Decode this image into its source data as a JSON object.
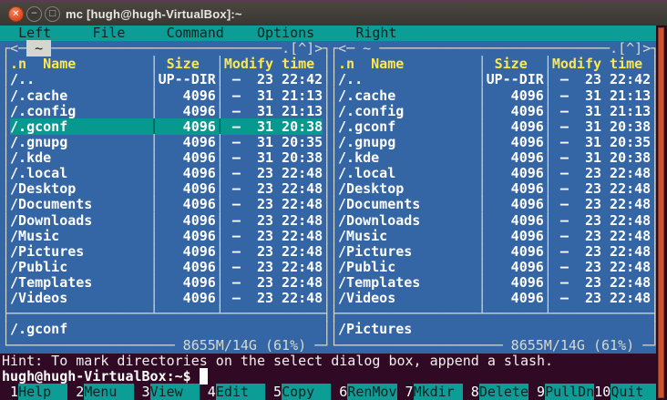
{
  "window": {
    "title": "mc [hugh@hugh-VirtualBox]:~",
    "buttons": {
      "close": "close-icon",
      "minimize": "minimize-icon",
      "maximize": "maximize-icon"
    }
  },
  "menu": {
    "items": [
      {
        "label": "Left"
      },
      {
        "label": "File"
      },
      {
        "label": "Command"
      },
      {
        "label": "Options"
      },
      {
        "label": "Right"
      }
    ]
  },
  "panel_chrome": {
    "history_back": "<",
    "history_forward": ">",
    "cd_up": "[^]",
    "show_hidden": ".",
    "date_dash": "—"
  },
  "columns": {
    "sort_indicator": ".n",
    "name": "Name",
    "size": "Size",
    "mtime": "Modify time"
  },
  "panels": {
    "left": {
      "path": "~",
      "active": true,
      "selected_index": 3,
      "mini_status": "/.gconf",
      "disk_usage": "8655M/14G (61%)",
      "files": [
        {
          "name": "/..",
          "size": "UP--DIR",
          "time": "23 22:42"
        },
        {
          "name": "/.cache",
          "size": "4096",
          "time": "31 21:13"
        },
        {
          "name": "/.config",
          "size": "4096",
          "time": "31 21:13"
        },
        {
          "name": "/.gconf",
          "size": "4096",
          "time": "31 20:38"
        },
        {
          "name": "/.gnupg",
          "size": "4096",
          "time": "31 20:35"
        },
        {
          "name": "/.kde",
          "size": "4096",
          "time": "31 20:38"
        },
        {
          "name": "/.local",
          "size": "4096",
          "time": "23 22:48"
        },
        {
          "name": "/Desktop",
          "size": "4096",
          "time": "23 22:48"
        },
        {
          "name": "/Documents",
          "size": "4096",
          "time": "23 22:48"
        },
        {
          "name": "/Downloads",
          "size": "4096",
          "time": "23 22:48"
        },
        {
          "name": "/Music",
          "size": "4096",
          "time": "23 22:48"
        },
        {
          "name": "/Pictures",
          "size": "4096",
          "time": "23 22:48"
        },
        {
          "name": "/Public",
          "size": "4096",
          "time": "23 22:48"
        },
        {
          "name": "/Templates",
          "size": "4096",
          "time": "23 22:48"
        },
        {
          "name": "/Videos",
          "size": "4096",
          "time": "23 22:48"
        }
      ]
    },
    "right": {
      "path": "~",
      "active": false,
      "selected_index": -1,
      "mini_status": "/Pictures",
      "disk_usage": "8655M/14G (61%)",
      "files": [
        {
          "name": "/..",
          "size": "UP--DIR",
          "time": "23 22:42"
        },
        {
          "name": "/.cache",
          "size": "4096",
          "time": "31 21:13"
        },
        {
          "name": "/.config",
          "size": "4096",
          "time": "31 21:13"
        },
        {
          "name": "/.gconf",
          "size": "4096",
          "time": "31 20:38"
        },
        {
          "name": "/.gnupg",
          "size": "4096",
          "time": "31 20:35"
        },
        {
          "name": "/.kde",
          "size": "4096",
          "time": "31 20:38"
        },
        {
          "name": "/.local",
          "size": "4096",
          "time": "23 22:48"
        },
        {
          "name": "/Desktop",
          "size": "4096",
          "time": "23 22:48"
        },
        {
          "name": "/Documents",
          "size": "4096",
          "time": "23 22:48"
        },
        {
          "name": "/Downloads",
          "size": "4096",
          "time": "23 22:48"
        },
        {
          "name": "/Music",
          "size": "4096",
          "time": "23 22:48"
        },
        {
          "name": "/Pictures",
          "size": "4096",
          "time": "23 22:48"
        },
        {
          "name": "/Public",
          "size": "4096",
          "time": "23 22:48"
        },
        {
          "name": "/Templates",
          "size": "4096",
          "time": "23 22:48"
        },
        {
          "name": "/Videos",
          "size": "4096",
          "time": "23 22:48"
        }
      ]
    }
  },
  "hint": "Hint: To mark directories on the select dialog box, append a slash.",
  "prompt": "hugh@hugh-VirtualBox:~$",
  "keybar": [
    {
      "num": "1",
      "label": "Help"
    },
    {
      "num": "2",
      "label": "Menu"
    },
    {
      "num": "3",
      "label": "View"
    },
    {
      "num": "4",
      "label": "Edit"
    },
    {
      "num": "5",
      "label": "Copy"
    },
    {
      "num": "6",
      "label": "RenMov"
    },
    {
      "num": "7",
      "label": "Mkdir"
    },
    {
      "num": "8",
      "label": "Delete"
    },
    {
      "num": "9",
      "label": "PullDn"
    },
    {
      "num": "10",
      "label": "Quit"
    }
  ],
  "colors": {
    "panel_bg": "#3465a4",
    "accent_teal": "#0b9d96",
    "selection_teal": "#07988e",
    "terminal_bg": "#300a24",
    "header_yellow": "#fce94f",
    "frame": "#d6d9d0",
    "scrollbar_thumb": "#cf5130",
    "close_button": "#df4b1e"
  }
}
